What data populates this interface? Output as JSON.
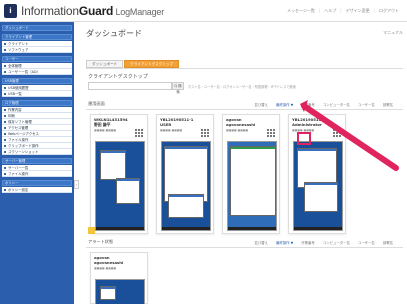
{
  "header": {
    "logo_letter": "i",
    "brand_part1": "Information",
    "brand_part2": "Guard",
    "brand_suffix": " LogManager",
    "nav": [
      "メッセージ一覧",
      "ヘルプ",
      "デザイン変更",
      "ログアウト"
    ]
  },
  "sidebar": {
    "groups": [
      {
        "head": "ダッシュボード",
        "items": []
      },
      {
        "head": "クライアント管理",
        "items": [
          "クライアント",
          "ソフトウェア"
        ]
      },
      {
        "head": "ユーザー",
        "items": [
          "全体管理",
          "ユーザー一覧（AD）"
        ]
      },
      {
        "head": "USB管理",
        "items": [
          "USB使用履歴",
          "USB一覧"
        ]
      },
      {
        "head": "ログ管理",
        "items": [
          "作業内容",
          "印刷",
          "保存ソフト管理",
          "アクセス管理",
          "Webページアクセス",
          "ファイル操作",
          "クリップボード操作",
          "スクリーンショット"
        ]
      },
      {
        "head": "サーバー管理",
        "items": [
          "サーバー一覧",
          "ファイル操作"
        ]
      },
      {
        "head": "ポリシー",
        "items": [
          "ポリシー設定"
        ]
      }
    ]
  },
  "main": {
    "title": "ダッシュボード",
    "top_right": "マニュアル",
    "tabs": [
      {
        "label": "ダッシュボード",
        "active": false
      },
      {
        "label": "クライアントデスクトップ",
        "active": true
      }
    ],
    "section_title": "クライアントデスクトップ",
    "search": {
      "placeholder": "",
      "button": "Q 検索",
      "hint": "ホスト名・ユーザー名・ログオンユーザー名・所属部署・IPアドレスで検索"
    },
    "groups": [
      {
        "title": "運用画面",
        "cols": [
          "並び替え",
          "最終操作 ▼",
          "作業番号",
          "コンピューター名",
          "ユーザー名",
          "部署名"
        ]
      },
      {
        "title": "アラート状態",
        "cols": [
          "並び替え",
          "最終操作 ▼",
          "作業番号",
          "コンピューター名",
          "ユーザー名",
          "部署名"
        ]
      }
    ],
    "cards": [
      {
        "name": "WKLN1L431594\n野田 謙平",
        "sub": "■■■■ ■■■■"
      },
      {
        "name": "YBL20190511-1\nUSER",
        "sub": "■■■■ ■■■■"
      },
      {
        "name": "agovan\nagovanesashi",
        "sub": "■■■■ ■■■■"
      },
      {
        "name": "YBL20190511-1\nAdministrator",
        "sub": "■■■■ ■■■■"
      }
    ],
    "alert_card": {
      "name": "agovan\nagovanesashi",
      "sub": "■■■■ ■■■■"
    }
  },
  "colors": {
    "sidebar": "#2b5fae",
    "accent_tab": "#f3a037",
    "highlight": "#e0245e"
  }
}
